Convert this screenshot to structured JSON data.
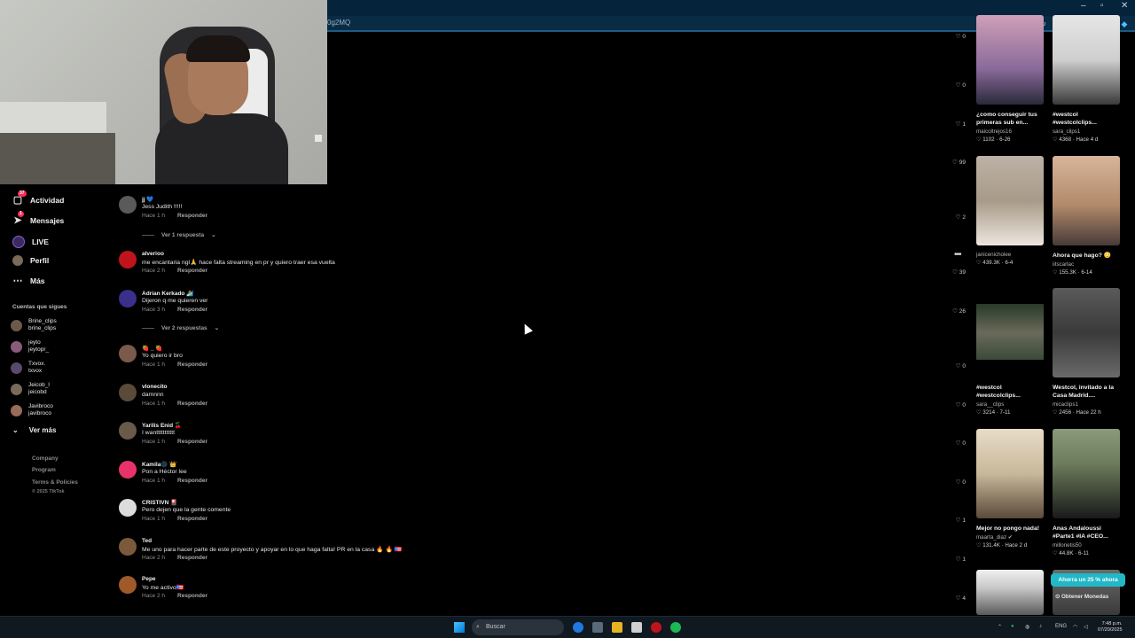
{
  "browser": {
    "url_fragment": "0g2MQ",
    "window_controls": [
      "–",
      "▫",
      "✕"
    ]
  },
  "nav": {
    "items": [
      {
        "label": "Actividad",
        "icon": "activity-icon",
        "badge": "37"
      },
      {
        "label": "Mensajes",
        "icon": "paper-plane-icon",
        "badge": "1"
      },
      {
        "label": "LIVE",
        "icon": "live-icon"
      },
      {
        "label": "Perfil",
        "icon": "profile-avatar"
      },
      {
        "label": "Más",
        "icon": "more-dots-icon"
      }
    ],
    "following_title": "Cuentas que sigues",
    "following": [
      {
        "name": "Brine_clips",
        "handle": "brine_clips",
        "color": "#6b5a4a"
      },
      {
        "name": "jeyto",
        "handle": "jeytopr_",
        "color": "#8a5a7a"
      },
      {
        "name": "Txvox.",
        "handle": "txvox",
        "color": "#5a4a6a"
      },
      {
        "name": "Jeicob_l",
        "handle": "jeicobd",
        "color": "#7a6a5a"
      },
      {
        "name": "Javibroco",
        "handle": "javibroco",
        "color": "#9a6a5a"
      }
    ],
    "see_more": "Ver más",
    "footer": [
      "Company",
      "Program",
      "Terms & Policies"
    ],
    "copyright": "© 2025 TikTok"
  },
  "comments": [
    {
      "user": "jj 💙",
      "text": "Jess Judith !!!!!",
      "time": "Hace 1 h",
      "reply": "Responder",
      "likes": "2",
      "avatar": "#5a5a5a"
    },
    {
      "user": "alverioo",
      "text": "me encantaria ngl🙏 hace falta streaming en pr y quiero traer esa vuelta",
      "time": "Hace 2 h",
      "reply": "Responder",
      "likes": "39",
      "avatar": "#c0141c"
    },
    {
      "user": "Adrian Kerkado 🏄",
      "text": "Dijeron q me quieren ver",
      "time": "Hace 3 h",
      "reply": "Responder",
      "likes": "26",
      "avatar": "#3a2f8a"
    },
    {
      "user": "🍓 _ 🍓",
      "text": "Yo quiero ir bro",
      "time": "Hace 1 h",
      "reply": "Responder",
      "likes": "0",
      "avatar": "#7a5a4a"
    },
    {
      "user": "vlonecito",
      "text": "damnnn",
      "time": "Hace 1 h",
      "reply": "Responder",
      "likes": "0",
      "avatar": "#5a4a3a"
    },
    {
      "user": "Yarilis Enid 🍒",
      "text": "I wanttttttttttt",
      "time": "Hace 1 h",
      "reply": "Responder",
      "likes": "0",
      "avatar": "#6a5a4a"
    },
    {
      "user": "Kamila🌑 👑",
      "text": "Pon a Héctor lee",
      "time": "Hace 1 h",
      "reply": "Responder",
      "likes": "0",
      "avatar": "#e8336a"
    },
    {
      "user": "CRISTIVN 🎴",
      "text": "Pero dejen que la gente comente",
      "time": "Hace 1 h",
      "reply": "Responder",
      "likes": "1",
      "avatar": "#dcdcdc"
    },
    {
      "user": "Ted",
      "text": "Me uno para hacer parte de este proyecto y apoyar en lo que haga falta! PR en la casa 🔥 🔥 🇵🇷",
      "time": "Hace 2 h",
      "reply": "Responder",
      "likes": "1",
      "avatar": "#7a5a3a"
    },
    {
      "user": "Pepe",
      "text": "Yo me activo🇵🇷",
      "time": "Hace 2 h",
      "reply": "Responder",
      "likes": "4",
      "avatar": "#a05a2a"
    }
  ],
  "reply_toggles": [
    "Ver 1 respuesta",
    "Ver 2 respuestas"
  ],
  "upper_likes": [
    "0",
    "0",
    "1",
    "99"
  ],
  "videos": [
    {
      "title": "¿como conseguir tus primeras sub en...",
      "author": "maicoltrejos16",
      "stats": "1102 · 6-26",
      "color": "#8a6a9a"
    },
    {
      "title": "#westcol #westcolclips...",
      "author": "sara_clips1",
      "stats": "4368 · Hace 4 d",
      "color": "#d8d8d8"
    },
    {
      "title": "",
      "author": "janicenicholee",
      "stats": "439.3K · 6-4",
      "color": "#a89a88"
    },
    {
      "title": "Ahora que hago? 😳",
      "author": "iitscarlac",
      "stats": "155.3K · 6-14",
      "color": "#b08a6a"
    },
    {
      "title": "#westcol #westcolclips...",
      "author": "sara__clips",
      "stats": "3214 · 7-11",
      "color": "#3a4a3a"
    },
    {
      "title": "Westcol, invitado a la Casa Madrid....",
      "author": "micaclips1",
      "stats": "2456 · Hace 22 h",
      "color": "#4a4a4a"
    },
    {
      "title": "Mejor no pongo nada!",
      "author": "maarta_diaz ✔",
      "stats": "131.4K · Hace 2 d",
      "color": "#c8b89a"
    },
    {
      "title": "Anas Andaloussi #Parte1 #IA #CEO...",
      "author": "millonetis50",
      "stats": "44.8K · 6-11",
      "color": "#6a7a5a"
    }
  ],
  "promo": "Ahorra un 25 % ahora",
  "coins": "Obtener Monedas",
  "taskbar": {
    "search_placeholder": "Buscar",
    "lang": "ENG",
    "time": "7:48 p.m.",
    "date": "07/20/2025"
  }
}
